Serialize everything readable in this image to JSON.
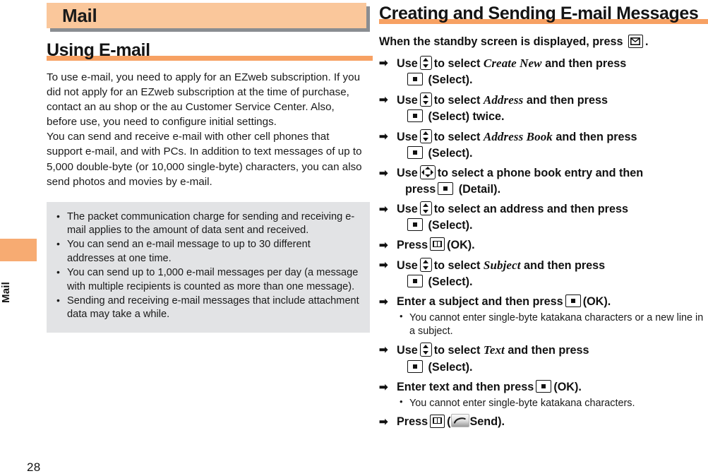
{
  "page": {
    "number": "28",
    "side_tab_label": "Mail"
  },
  "chapter": {
    "title": "Mail"
  },
  "left_column": {
    "section_title": "Using E-mail",
    "paragraphs": [
      "To use e-mail, you need to apply for an EZweb subscription. If you did not apply for an EZweb subscription at the time of purchase, contact an au shop or the au Customer Service Center. Also, before use, you need to configure initial settings.",
      "You can send and receive e-mail with other cell phones that support e-mail, and with PCs. In addition to text messages of up to 5,000 double-byte (or 10,000 single-byte) characters, you can also send photos and movies by e-mail."
    ],
    "note_box": {
      "items": [
        "The packet communication charge for sending and receiving e-mail applies to the amount of data sent and received.",
        "You can send an e-mail message to up to 30 different addresses at one time.",
        "You can send up to 1,000 e-mail messages per day (a message with multiple recipients is counted as more than one message).",
        "Sending and receiving e-mail messages that include attachment data may take a while."
      ]
    }
  },
  "right_column": {
    "section_title": "Creating and Sending E-mail Messages",
    "intro": {
      "before_icon": "When the standby screen is displayed, press",
      "icon": "envelope-key-icon",
      "after_icon": "."
    },
    "steps": [
      {
        "arrow": "➡",
        "line1_before_key": "Use",
        "key1": "updown-key-icon",
        "line1_mid": "to select",
        "ui_label": "Create New",
        "line1_after": "and then press",
        "key2": "center-key-icon",
        "line2_after": "(Select)."
      },
      {
        "arrow": "➡",
        "line1_before_key": "Use",
        "key1": "updown-key-icon",
        "line1_mid": "to select",
        "ui_label": "Address",
        "line1_after": "and then press",
        "key2": "center-key-icon",
        "line2_after": "(Select) twice."
      },
      {
        "arrow": "➡",
        "line1_before_key": "Use",
        "key1": "updown-key-icon",
        "line1_mid": "to select",
        "ui_label": "Address Book",
        "line1_after": "and then press",
        "key2": "center-key-icon",
        "line2_after": "(Select)."
      },
      {
        "arrow": "➡",
        "line1_before_key": "Use",
        "key1": "fourway-key-icon",
        "line1_mid": "to select a phone book entry and then",
        "ui_label": "",
        "line1_after": "press",
        "key2": "center-key-icon",
        "line2_after": "(Detail)."
      },
      {
        "arrow": "➡",
        "line1_before_key": "Use",
        "key1": "updown-key-icon",
        "line1_mid": "to select an address and then press",
        "ui_label": "",
        "line1_after": "",
        "key2": "center-key-icon",
        "line2_after": "(Select)."
      },
      {
        "arrow": "➡",
        "line1_before_key": "Press",
        "key1": "book-key-icon",
        "line1_mid": "(OK).",
        "ui_label": "",
        "line1_after": "",
        "key2": "",
        "line2_after": ""
      },
      {
        "arrow": "➡",
        "line1_before_key": "Use",
        "key1": "updown-key-icon",
        "line1_mid": "to select",
        "ui_label": "Subject",
        "line1_after": "and then press",
        "key2": "center-key-icon",
        "line2_after": "(Select)."
      },
      {
        "arrow": "➡",
        "line1_before_key": "Enter a subject and then press",
        "key1": "center-key-icon",
        "line1_mid": "(OK).",
        "ui_label": "",
        "line1_after": "",
        "key2": "",
        "line2_after": "",
        "substep": "You cannot enter single-byte katakana characters or a new line in a subject."
      },
      {
        "arrow": "➡",
        "line1_before_key": "Use",
        "key1": "updown-key-icon",
        "line1_mid": "to select",
        "ui_label": "Text",
        "line1_after": "and then press",
        "key2": "center-key-icon",
        "line2_after": "(Select)."
      },
      {
        "arrow": "➡",
        "line1_before_key": "Enter text and then press",
        "key1": "center-key-icon",
        "line1_mid": "(OK).",
        "ui_label": "",
        "line1_after": "",
        "key2": "",
        "line2_after": "",
        "substep": "You cannot enter single-byte katakana characters."
      },
      {
        "arrow": "➡",
        "line1_before_key": "Press",
        "key1": "book-key-icon",
        "line1_mid": "(",
        "send_icon": "send-softkey-icon",
        "line1_after": "Send).",
        "key2": "",
        "line2_after": ""
      }
    ]
  },
  "colors": {
    "accent_orange": "#f7a163",
    "banner_peach": "#fac79b",
    "banner_shadow": "#8a8d91",
    "note_gray": "#e2e3e5",
    "text": "#1a1a1a"
  }
}
